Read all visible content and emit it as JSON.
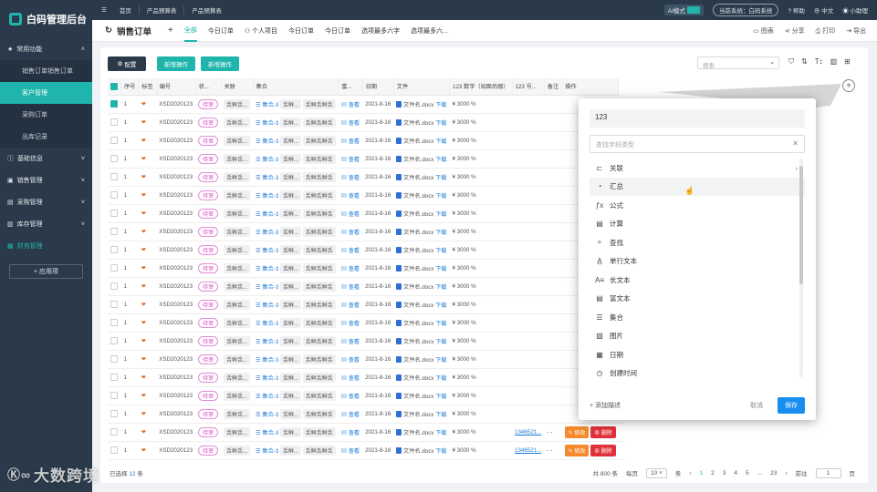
{
  "app": {
    "title": "白码管理后台"
  },
  "sidebar": {
    "groups": [
      {
        "label": "常用功能",
        "items": [
          "销售订单销售订单",
          "客户管理",
          "采购订单",
          "出库记录"
        ]
      },
      {
        "label": "基础信息"
      },
      {
        "label": "销售管理"
      },
      {
        "label": "采购管理"
      },
      {
        "label": "库存管理"
      },
      {
        "label": "财务管理"
      }
    ],
    "add_label": "+ 应用项"
  },
  "topbar": {
    "nav": [
      "首页",
      "产品预算表",
      "产品预算表"
    ],
    "ai_label": "AI模式",
    "system": "当前系统：白码系统",
    "help": "帮助",
    "lang": "中文",
    "user": "小助理"
  },
  "header": {
    "title": "销售订单",
    "tabs": [
      "全部",
      "今日订单",
      "个人项目",
      "今日订单",
      "今日订单",
      "选项最多六字",
      "选项最多六..."
    ],
    "actions": [
      "图表",
      "分享",
      "打印",
      "导出"
    ]
  },
  "toolbar": {
    "config": "配置",
    "new1": "新增操作",
    "new2": "新增操作",
    "search_placeholder": "搜索"
  },
  "table": {
    "headers": [
      "序号",
      "标签",
      "编号",
      "状...",
      "关联",
      "集合",
      "富...",
      "日期",
      "文件",
      "123 数字（如面后缀）",
      "123 号...",
      "备注",
      "操作"
    ],
    "row": {
      "seq": "1",
      "code": "XSD2020123",
      "status": "待审",
      "rel": "舌鲜舌...",
      "set1": "集合-3",
      "set2": "舌鲜...",
      "set3": "舌鲜舌鲜舌",
      "rich": "查看",
      "date": "2021-8-16",
      "file": "文件名.docx",
      "dl": "下载",
      "amount": "¥ 3000 %",
      "link": "1346521...",
      "note": "- -",
      "edit": "修改",
      "del": "删除"
    },
    "row_count": 20
  },
  "footer": {
    "selected_prefix": "已选择",
    "selected_count": "12",
    "selected_suffix": "条",
    "total": "共 800 条",
    "per_page_label": "每页",
    "per_page": "10",
    "unit": "条",
    "pages": [
      "1",
      "2",
      "3",
      "4",
      "5",
      "...",
      "23"
    ],
    "goto_label": "前往",
    "goto_value": "1",
    "goto_suffix": "页"
  },
  "popup": {
    "input_value": "123",
    "search_placeholder": "查找字段类型",
    "items": [
      {
        "label": "关联",
        "icon": "link-icon"
      },
      {
        "label": "汇总",
        "icon": "pie-icon"
      },
      {
        "label": "公式",
        "icon": "fx-icon"
      },
      {
        "label": "计算",
        "icon": "calc-icon"
      },
      {
        "label": "查找",
        "icon": "search-icon"
      },
      {
        "label": "单行文本",
        "icon": "text-icon"
      },
      {
        "label": "长文本",
        "icon": "longtext-icon"
      },
      {
        "label": "富文本",
        "icon": "richtext-icon"
      },
      {
        "label": "集合",
        "icon": "set-icon"
      },
      {
        "label": "图片",
        "icon": "image-icon"
      },
      {
        "label": "日期",
        "icon": "calendar-icon"
      },
      {
        "label": "创建时间",
        "icon": "clock-icon"
      }
    ],
    "add_desc": "+ 添加描述",
    "cancel": "取消",
    "save": "保存"
  },
  "watermark": "大数跨境",
  "colors": {
    "accent": "#1fb5ac",
    "sidebar": "#2b3a4a",
    "primary": "#1a8ef0",
    "danger": "#e0303a"
  }
}
